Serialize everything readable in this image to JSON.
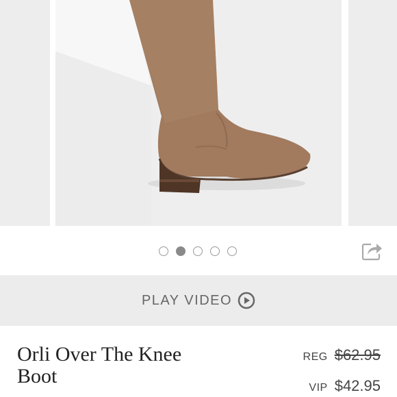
{
  "gallery": {
    "image_alt": "Orli Over The Knee Boot",
    "current_slide": 2,
    "slide_count": 5
  },
  "actions": {
    "share_icon": "share-icon",
    "video_label": "PLAY VIDEO",
    "video_icon": "play-circle-icon"
  },
  "product": {
    "title": "Orli Over The Knee Boot",
    "reg_label": "REG",
    "reg_price": "$62.95",
    "vip_label": "VIP",
    "vip_price": "$42.95"
  },
  "colors": {
    "background": "#ffffff",
    "image_background": "#eeeeee",
    "video_bar": "#ececec",
    "boot": "#a27a5e",
    "text": "#444444"
  }
}
